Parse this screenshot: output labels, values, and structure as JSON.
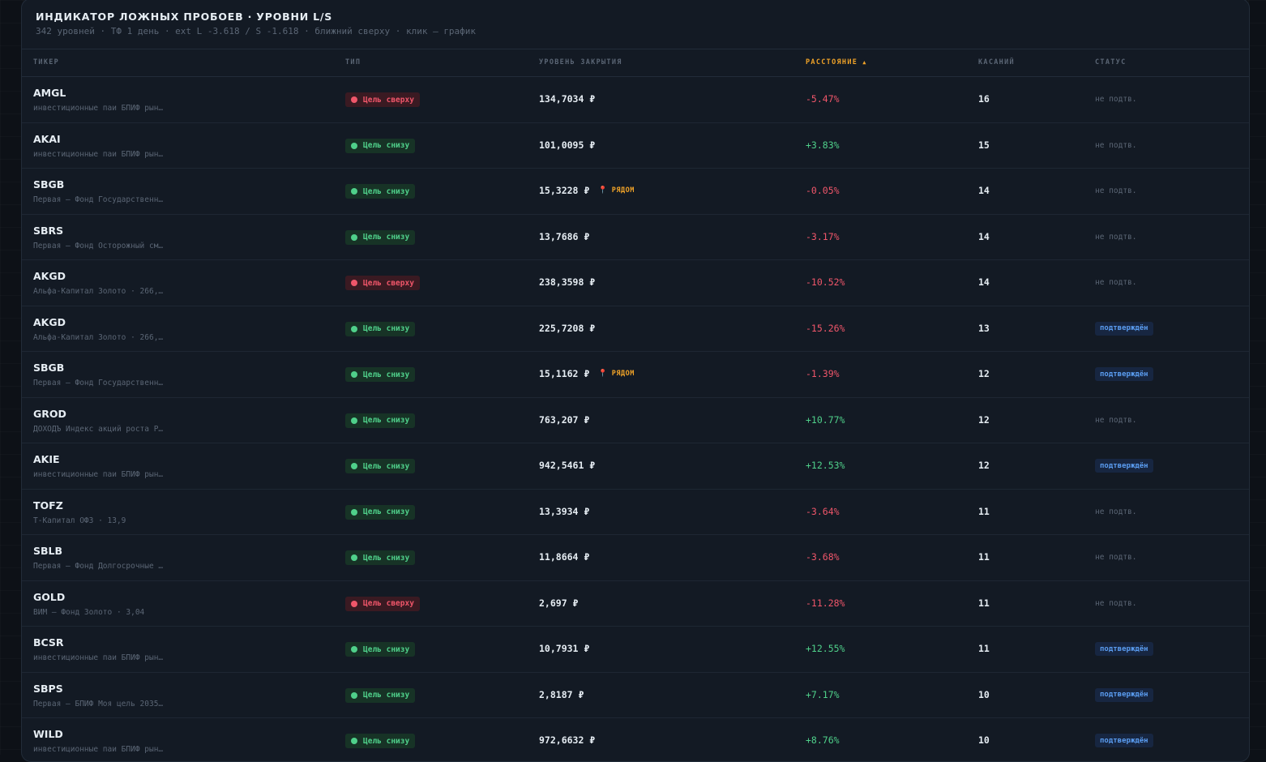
{
  "header": {
    "title": "ИНДИКАТОР ЛОЖНЫХ ПРОБОЕВ · УРОВНИ L/S",
    "subtitle": "342 уровней · ТФ 1 день · ext L -3.618 / S -1.618 · ближний сверху · клик — график"
  },
  "columns": {
    "ticker": "ТИКЕР",
    "type": "ТИП",
    "level": "УРОВЕНЬ ЗАКРЫТИЯ",
    "distance": "РАССТОЯНИЕ",
    "distance_sort_arrow": "▲",
    "touches": "КАСАНИЙ",
    "status": "СТАТУС"
  },
  "colors": {
    "accent": "#f0a328",
    "positive": "#4fd08a",
    "negative": "#f0566a",
    "confirmed": "#5a9cf0"
  },
  "rows": [
    {
      "ticker": "AMGL",
      "name": "инвестиционные паи БПИФ рын…",
      "type": "Цель сверху",
      "dir": "up",
      "level": "134,7034 ₽",
      "near": "",
      "distance": "-5.47%",
      "touches": "16",
      "status": "не подтв.",
      "confirmed": false
    },
    {
      "ticker": "AKAI",
      "name": "инвестиционные паи БПИФ рын…",
      "type": "Цель снизу",
      "dir": "down",
      "level": "101,0095 ₽",
      "near": "",
      "distance": "+3.83%",
      "touches": "15",
      "status": "не подтв.",
      "confirmed": false
    },
    {
      "ticker": "SBGB",
      "name": "Первая – Фонд Государственн…",
      "type": "Цель снизу",
      "dir": "down",
      "level": "15,3228 ₽",
      "near": "РЯДОМ",
      "distance": "-0.05%",
      "touches": "14",
      "status": "не подтв.",
      "confirmed": false
    },
    {
      "ticker": "SBRS",
      "name": "Первая – Фонд Осторожный см…",
      "type": "Цель снизу",
      "dir": "down",
      "level": "13,7686 ₽",
      "near": "",
      "distance": "-3.17%",
      "touches": "14",
      "status": "не подтв.",
      "confirmed": false
    },
    {
      "ticker": "AKGD",
      "name": "Альфа-Капитал Золото · 266,…",
      "type": "Цель сверху",
      "dir": "up",
      "level": "238,3598 ₽",
      "near": "",
      "distance": "-10.52%",
      "touches": "14",
      "status": "не подтв.",
      "confirmed": false
    },
    {
      "ticker": "AKGD",
      "name": "Альфа-Капитал Золото · 266,…",
      "type": "Цель снизу",
      "dir": "down",
      "level": "225,7208 ₽",
      "near": "",
      "distance": "-15.26%",
      "touches": "13",
      "status": "подтверждён",
      "confirmed": true
    },
    {
      "ticker": "SBGB",
      "name": "Первая – Фонд Государственн…",
      "type": "Цель снизу",
      "dir": "down",
      "level": "15,1162 ₽",
      "near": "РЯДОМ",
      "distance": "-1.39%",
      "touches": "12",
      "status": "подтверждён",
      "confirmed": true
    },
    {
      "ticker": "GROD",
      "name": "ДОХОДЪ Индекс акций роста Р…",
      "type": "Цель снизу",
      "dir": "down",
      "level": "763,207 ₽",
      "near": "",
      "distance": "+10.77%",
      "touches": "12",
      "status": "не подтв.",
      "confirmed": false
    },
    {
      "ticker": "AKIE",
      "name": "инвестиционные паи БПИФ рын…",
      "type": "Цель снизу",
      "dir": "down",
      "level": "942,5461 ₽",
      "near": "",
      "distance": "+12.53%",
      "touches": "12",
      "status": "подтверждён",
      "confirmed": true
    },
    {
      "ticker": "TOFZ",
      "name": "Т-Капитал ОФЗ · 13,9",
      "type": "Цель снизу",
      "dir": "down",
      "level": "13,3934 ₽",
      "near": "",
      "distance": "-3.64%",
      "touches": "11",
      "status": "не подтв.",
      "confirmed": false
    },
    {
      "ticker": "SBLB",
      "name": "Первая – Фонд Долгосрочные …",
      "type": "Цель снизу",
      "dir": "down",
      "level": "11,8664 ₽",
      "near": "",
      "distance": "-3.68%",
      "touches": "11",
      "status": "не подтв.",
      "confirmed": false
    },
    {
      "ticker": "GOLD",
      "name": "ВИМ – Фонд Золото · 3,04",
      "type": "Цель сверху",
      "dir": "up",
      "level": "2,697 ₽",
      "near": "",
      "distance": "-11.28%",
      "touches": "11",
      "status": "не подтв.",
      "confirmed": false
    },
    {
      "ticker": "BCSR",
      "name": "инвестиционные паи БПИФ рын…",
      "type": "Цель снизу",
      "dir": "down",
      "level": "10,7931 ₽",
      "near": "",
      "distance": "+12.55%",
      "touches": "11",
      "status": "подтверждён",
      "confirmed": true
    },
    {
      "ticker": "SBPS",
      "name": "Первая – БПИФ Моя цель 2035…",
      "type": "Цель снизу",
      "dir": "down",
      "level": "2,8187 ₽",
      "near": "",
      "distance": "+7.17%",
      "touches": "10",
      "status": "подтверждён",
      "confirmed": true
    },
    {
      "ticker": "WILD",
      "name": "инвестиционные паи БПИФ рын…",
      "type": "Цель снизу",
      "dir": "down",
      "level": "972,6632 ₽",
      "near": "",
      "distance": "+8.76%",
      "touches": "10",
      "status": "подтверждён",
      "confirmed": true
    }
  ]
}
